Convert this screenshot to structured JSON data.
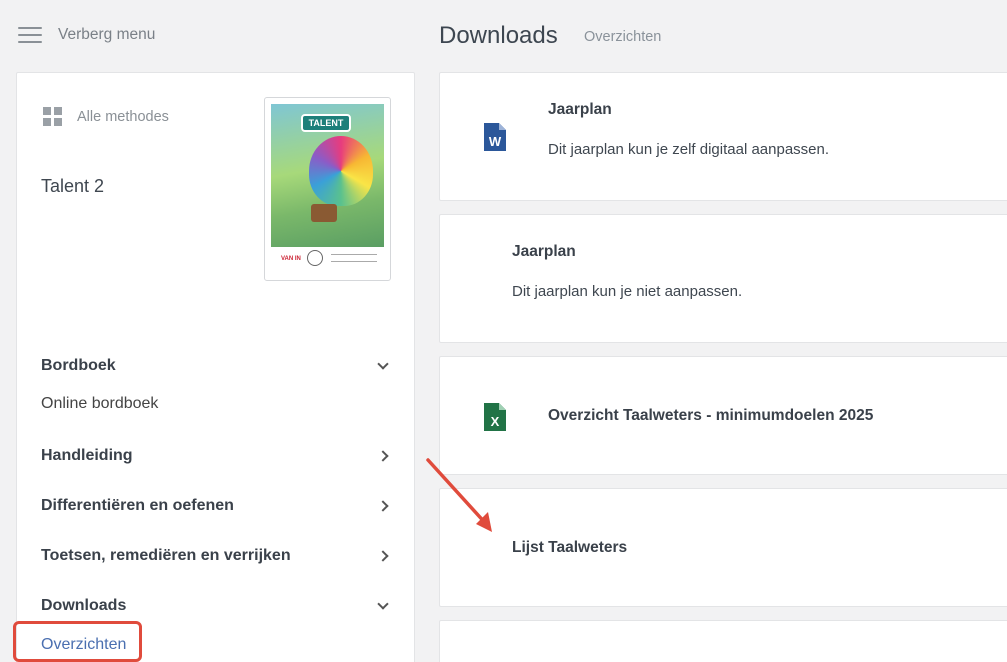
{
  "topbar": {
    "menu_label": "Verberg menu",
    "page_title": "Downloads",
    "breadcrumb": "Overzichten"
  },
  "sidebar": {
    "all_methods_label": "Alle methodes",
    "method_name": "Talent 2",
    "cover": {
      "title": "TALENT",
      "publisher": "VAN IN"
    },
    "sections": [
      {
        "label": "Bordboek",
        "expanded": true,
        "items": [
          "Online bordboek"
        ]
      },
      {
        "label": "Handleiding",
        "expanded": false
      },
      {
        "label": "Differentiëren en oefenen",
        "expanded": false
      },
      {
        "label": "Toetsen, remediëren en verrijken",
        "expanded": false
      },
      {
        "label": "Downloads",
        "expanded": true,
        "items": [
          "Overzichten"
        ]
      }
    ]
  },
  "cards": [
    {
      "icon": "word-file-icon",
      "title": "Jaarplan",
      "description": "Dit jaarplan kun je zelf digitaal aanpassen."
    },
    {
      "icon": "",
      "title": "Jaarplan",
      "description": "Dit jaarplan kun je niet aanpassen."
    },
    {
      "icon": "excel-file-icon",
      "title": "Overzicht Taalweters - minimumdoelen 2025",
      "description": ""
    },
    {
      "icon": "",
      "title": "Lijst Taalweters",
      "description": ""
    }
  ],
  "colors": {
    "word": "#2b579a",
    "excel": "#217346",
    "active_link": "#4a6fb0",
    "annotation": "#e04b3c"
  }
}
